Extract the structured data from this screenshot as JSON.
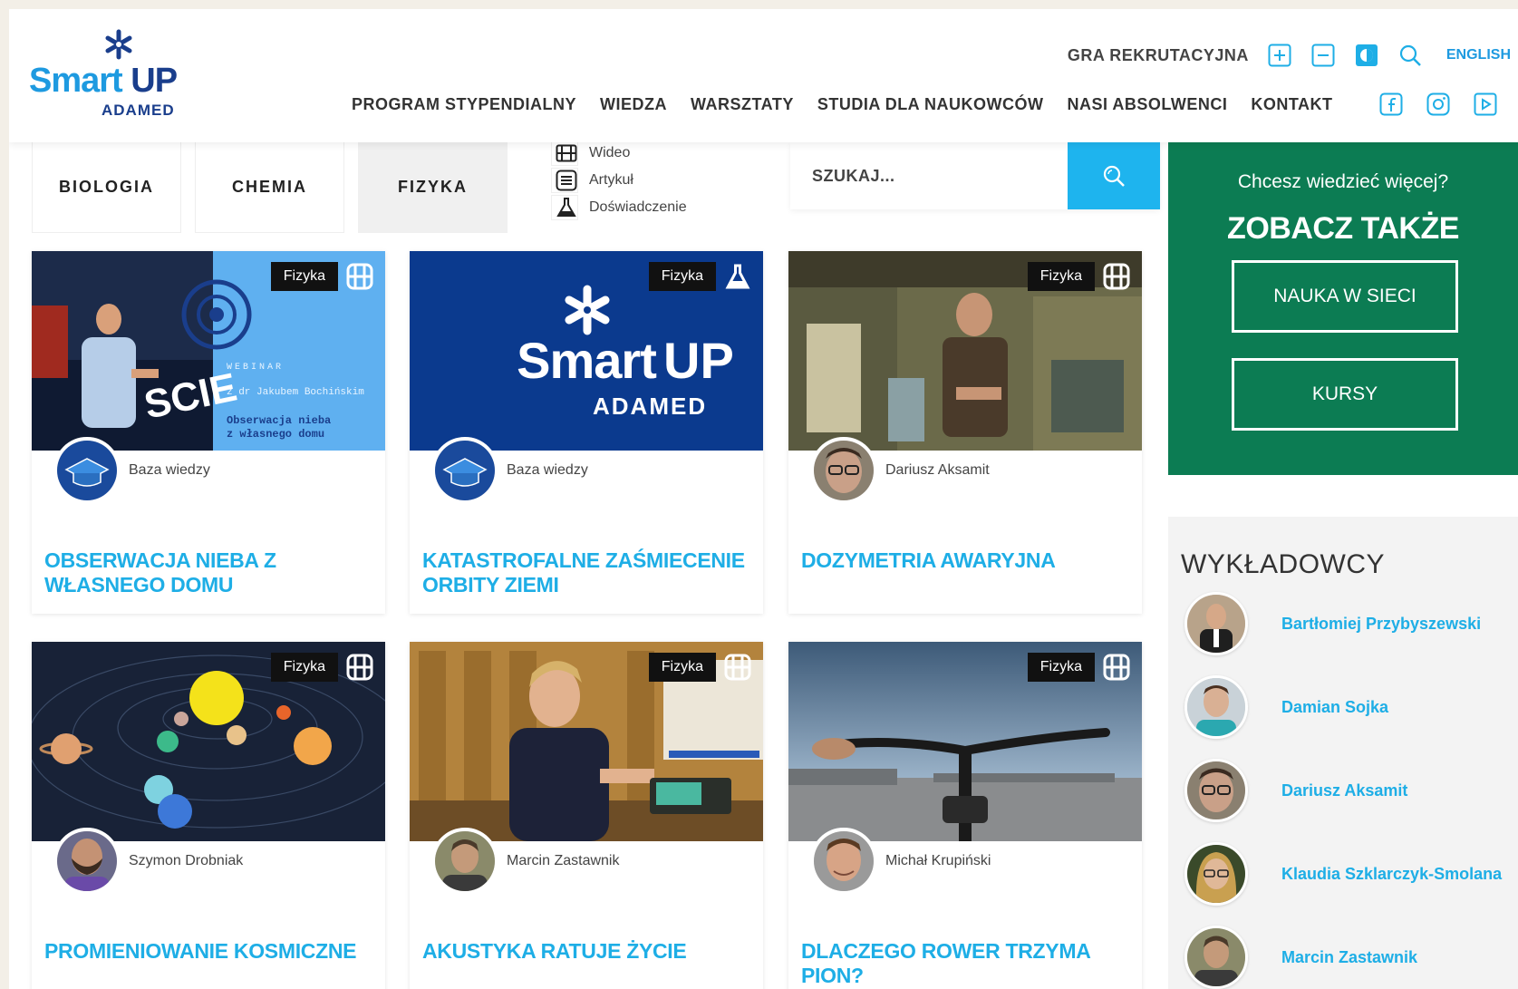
{
  "header": {
    "logo": {
      "word_left": "Smart",
      "word_right": "UP",
      "sub": "ADAMED"
    },
    "utility": {
      "recruit_game": "GRA REKRUTACYJNA",
      "language": "ENGLISH"
    },
    "nav": [
      "PROGRAM STYPENDIALNY",
      "WIEDZA",
      "WARSZTATY",
      "STUDIA DLA NAUKOWCÓW",
      "NASI ABSOLWENCI",
      "KONTAKT"
    ],
    "icons": [
      "font-increase-icon",
      "font-decrease-icon",
      "contrast-icon",
      "search-icon",
      "facebook-icon",
      "instagram-icon",
      "youtube-icon"
    ]
  },
  "filters": {
    "subjects": [
      {
        "label": "BIOLOGIA",
        "active": false
      },
      {
        "label": "CHEMIA",
        "active": false
      },
      {
        "label": "FIZYKA",
        "active": true
      }
    ],
    "types": [
      {
        "label": "Wideo",
        "icon": "film-icon"
      },
      {
        "label": "Artykuł",
        "icon": "article-icon"
      },
      {
        "label": "Doświadczenie",
        "icon": "flask-icon"
      }
    ]
  },
  "search": {
    "placeholder": "SZUKAJ..."
  },
  "cards": [
    {
      "badge": "Fizyka",
      "type_icon": "film-icon",
      "author": "Baza wiedzy",
      "title": "OBSERWACJA NIEBA Z WŁASNEGO DOMU"
    },
    {
      "badge": "Fizyka",
      "type_icon": "flask-icon",
      "author": "Baza wiedzy",
      "title": "KATASTROFALNE ZAŚMIECENIE ORBITY ZIEMI"
    },
    {
      "badge": "Fizyka",
      "type_icon": "film-icon",
      "author": "Dariusz Aksamit",
      "title": "DOZYMETRIA AWARYJNA"
    },
    {
      "badge": "Fizyka",
      "type_icon": "film-icon",
      "author": "Szymon Drobniak",
      "title": "PROMIENIOWANIE KOSMICZNE"
    },
    {
      "badge": "Fizyka",
      "type_icon": "film-icon",
      "author": "Marcin Zastawnik",
      "title": "AKUSTYKA RATUJE ŻYCIE"
    },
    {
      "badge": "Fizyka",
      "type_icon": "film-icon",
      "author": "Michał Krupiński",
      "title": "DLACZEGO ROWER TRZYMA PION?"
    }
  ],
  "thumb_text": {
    "webinar_lines": [
      "WEBINAR",
      "z dr Jakubem Bochińskim",
      "Obserwacja nieba",
      "z własnego domu"
    ],
    "scie": "SCIE"
  },
  "sidebar": {
    "cta": {
      "question": "Chcesz wiedzieć więcej?",
      "heading": "ZOBACZ TAKŻE",
      "buttons": [
        "NAUKA W SIECI",
        "KURSY"
      ]
    },
    "lecturers": {
      "heading": "WYKŁADOWCY",
      "items": [
        "Bartłomiej Przybyszewski",
        "Damian Sojka",
        "Dariusz Aksamit",
        "Klaudia Szklarczyk-Smolana",
        "Marcin Zastawnik"
      ]
    }
  },
  "colors": {
    "accent_blue": "#1eb4ee",
    "title_blue": "#1eaee6",
    "brand_green": "#0c7c53",
    "navy": "#1a3e8c"
  }
}
